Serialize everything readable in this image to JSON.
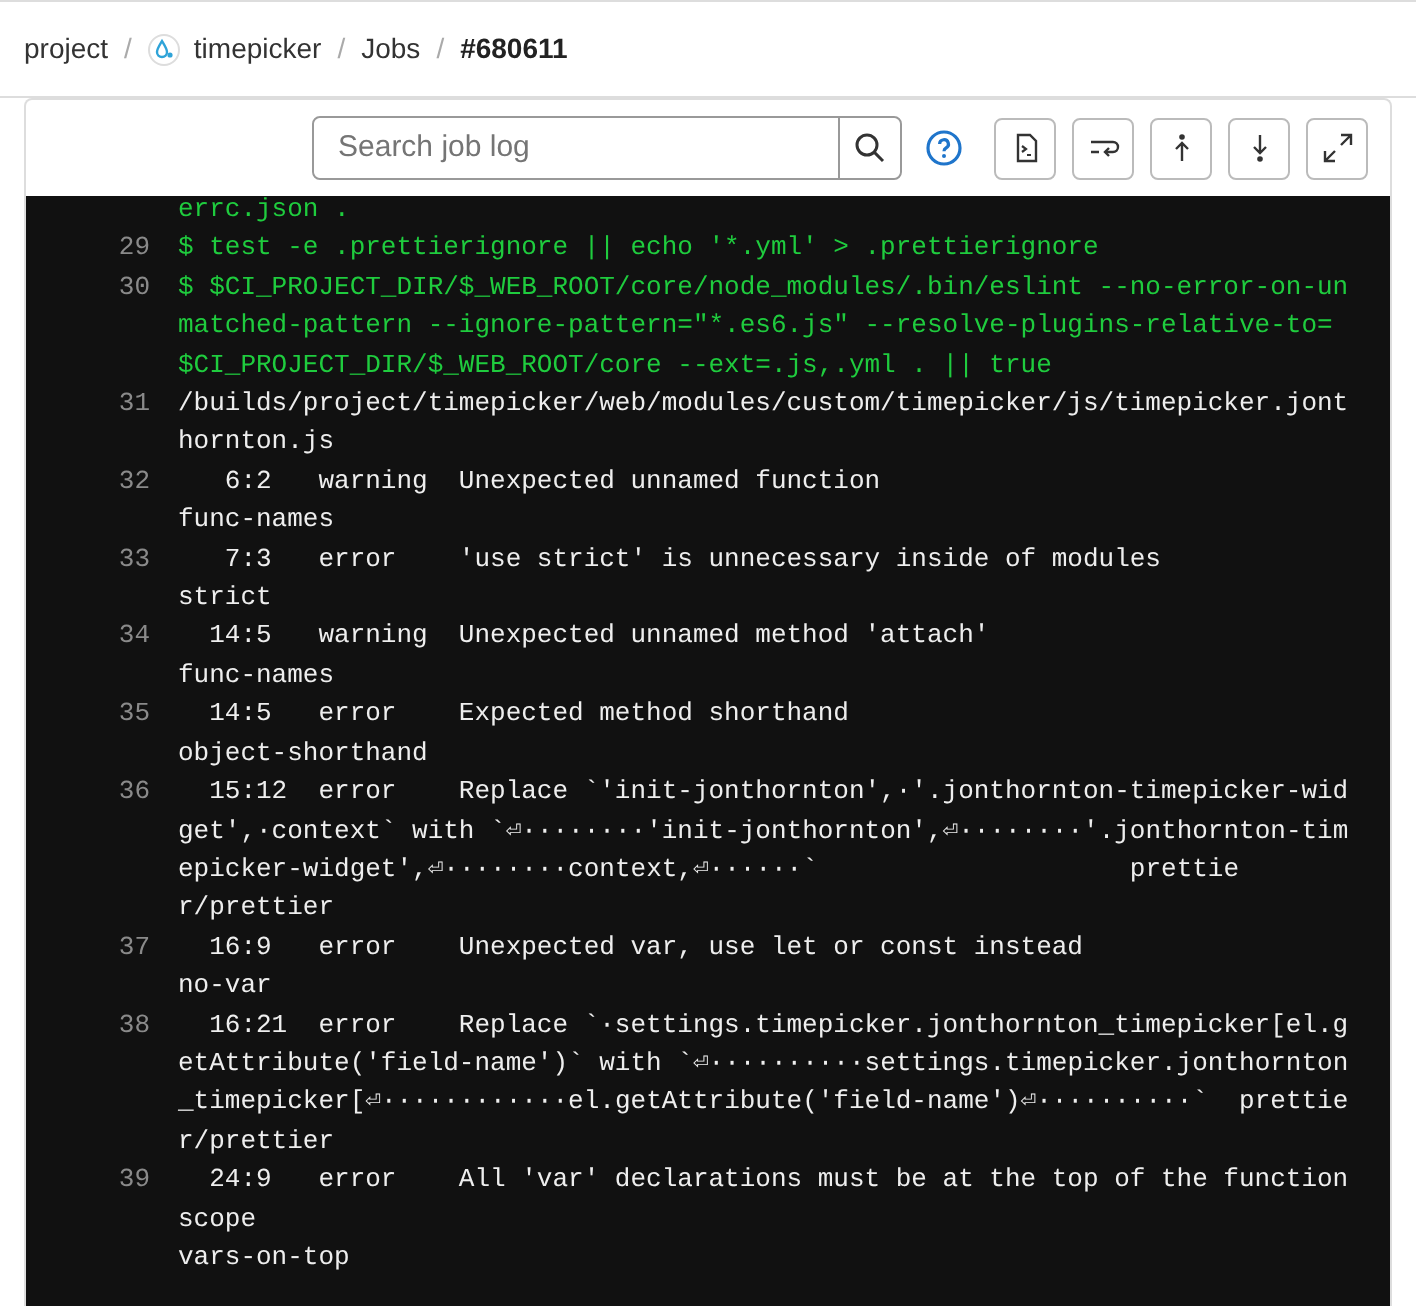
{
  "breadcrumb": [
    {
      "label": "project",
      "icon": false,
      "current": false
    },
    {
      "label": "timepicker",
      "icon": true,
      "current": false
    },
    {
      "label": "Jobs",
      "icon": false,
      "current": false
    },
    {
      "label": "#680611",
      "icon": false,
      "current": true
    }
  ],
  "breadcrumb_separator": "/",
  "toolbar": {
    "search": {
      "placeholder": "Search job log"
    }
  },
  "log": [
    {
      "kind": "command",
      "rows": [
        "errc.json ."
      ]
    },
    {
      "number": "29",
      "kind": "command",
      "rows": [
        "$ test -e .prettierignore || echo '*.yml' > .prettierignore"
      ]
    },
    {
      "number": "30",
      "kind": "command",
      "rows": [
        "$ $CI_PROJECT_DIR/$_WEB_ROOT/core/node_modules/.bin/eslint --no-error-on-un",
        "matched-pattern --ignore-pattern=\"*.es6.js\" --resolve-plugins-relative-to=",
        "$CI_PROJECT_DIR/$_WEB_ROOT/core --ext=.js,.yml . || true"
      ]
    },
    {
      "number": "31",
      "kind": "output",
      "rows": [
        "/builds/project/timepicker/web/modules/custom/timepicker/js/timepicker.jont",
        "hornton.js"
      ]
    },
    {
      "number": "32",
      "kind": "output",
      "rows": [
        "   6:2   warning  Unexpected unnamed function",
        "func-names"
      ]
    },
    {
      "number": "33",
      "kind": "output",
      "rows": [
        "   7:3   error    'use strict' is unnecessary inside of modules",
        "strict"
      ]
    },
    {
      "number": "34",
      "kind": "output",
      "rows": [
        "  14:5   warning  Unexpected unnamed method 'attach'",
        "func-names"
      ]
    },
    {
      "number": "35",
      "kind": "output",
      "rows": [
        "  14:5   error    Expected method shorthand",
        "object-shorthand"
      ]
    },
    {
      "number": "36",
      "kind": "output",
      "rows": [
        "  15:12  error    Replace `'init-jonthornton',·'.jonthornton-timepicker-wid",
        "get',·context` with `⏎········'init-jonthornton',⏎········'.jonthornton-tim",
        "epicker-widget',⏎········context,⏎······`                    prettie",
        "r/prettier"
      ]
    },
    {
      "number": "37",
      "kind": "output",
      "rows": [
        "  16:9   error    Unexpected var, use let or const instead",
        "no-var"
      ]
    },
    {
      "number": "38",
      "kind": "output",
      "rows": [
        "  16:21  error    Replace `·settings.timepicker.jonthornton_timepicker[el.g",
        "etAttribute('field-name')` with `⏎··········settings.timepicker.jonthornton",
        "_timepicker[⏎············el.getAttribute('field-name')⏎··········`  prettie",
        "r/prettier"
      ]
    },
    {
      "number": "39",
      "kind": "output",
      "rows": [
        "  24:9   error    All 'var' declarations must be at the top of the function",
        "scope",
        "vars-on-top"
      ]
    }
  ]
}
